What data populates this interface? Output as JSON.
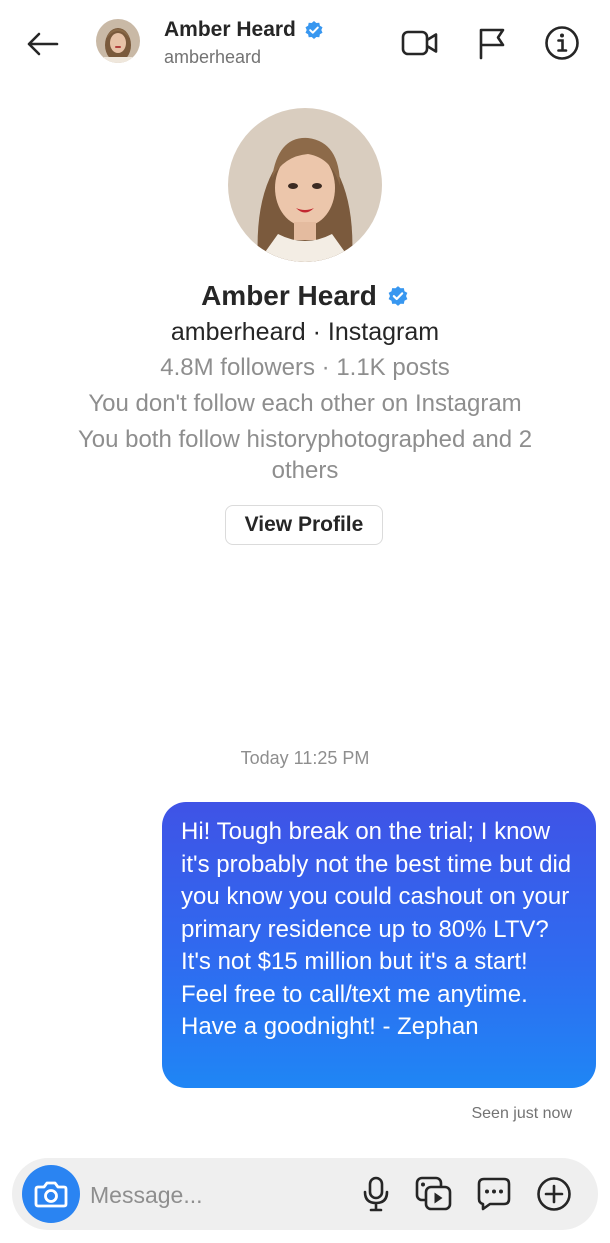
{
  "header": {
    "name": "Amber Heard",
    "username": "amberheard",
    "icons": [
      "back-arrow-icon",
      "video-call-icon",
      "flag-icon",
      "info-icon"
    ]
  },
  "profile": {
    "name": "Amber Heard",
    "handle_line": "amberheard · Instagram",
    "stats_line": "4.8M followers · 1.1K posts",
    "follow_line": "You don't follow each other on Instagram",
    "mutual_line": "You both follow historyphotographed and 2 others",
    "view_profile_label": "View Profile"
  },
  "thread": {
    "timestamp": "Today 11:25 PM",
    "messages": [
      {
        "direction": "outgoing",
        "text": "Hi! Tough break on the trial; I know it's probably not the best time but did you know you could cashout on your primary residence up to 80% LTV? It's not $15 million but it's a start! Feel free to call/text me anytime. Have a goodnight! - Zephan"
      }
    ],
    "seen_status": "Seen just now"
  },
  "composer": {
    "placeholder": "Message...",
    "icons": [
      "camera-icon",
      "microphone-icon",
      "gallery-icon",
      "chat-sticker-icon",
      "add-icon"
    ]
  },
  "colors": {
    "accent_blue": "#2a84f2",
    "verified_blue": "#3897f0",
    "bubble_top": "#3f53e6",
    "bubble_bottom": "#1f86f5"
  }
}
